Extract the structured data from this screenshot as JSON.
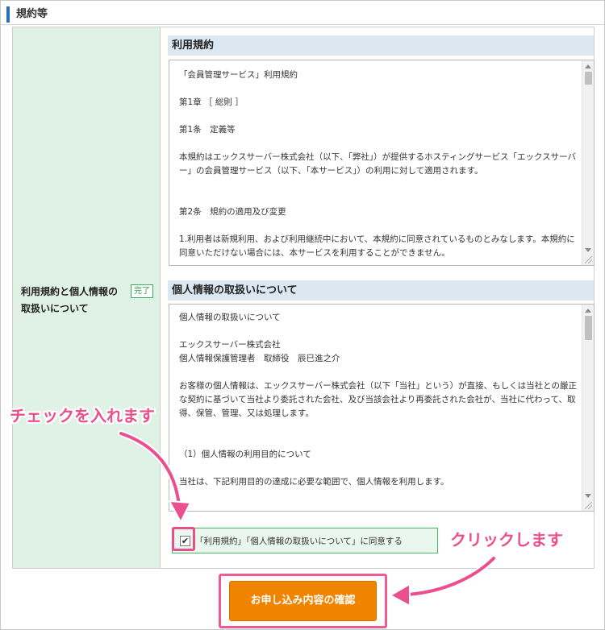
{
  "section": {
    "title": "規約等"
  },
  "row": {
    "label": "利用規約と個人情報の取扱いについて",
    "status_badge": "完了"
  },
  "terms": {
    "heading": "利用規約",
    "lines": [
      "「会員管理サービス」利用規約",
      "",
      "第1章 ［ 総則 ］",
      "",
      "第1条　定義等",
      "",
      "本規約はエックスサーバー株式会社（以下、「弊社」）が提供するホスティングサービス「エックスサーバー」の会員管理サービス（以下、「本サービス」）の利用に対して適用されます。",
      "",
      "",
      "第2条　規約の適用及び変更",
      "",
      "1.利用者は新規利用、および利用継続中において、本規約に同意されているものとみなします。本規約に同意いただけない場合には、本サービスを利用することができません。"
    ]
  },
  "privacy": {
    "heading": "個人情報の取扱いについて",
    "lines": [
      "個人情報の取扱いについて",
      "",
      "エックスサーバー株式会社",
      "個人情報保護管理者　取締役　辰巳進之介",
      "",
      "お客様の個人情報は、エックスサーバー株式会社（以下「当社」という）が直接、もしくは当社との厳正な契約に基づいて当社より委託された会社、及び当該会社より再委託された会社が、当社に代わって、取得、保管、管理、又は処理します。",
      "",
      "",
      "（1）個人情報の利用目的について",
      "",
      "当社は、下記利用目的の達成に必要な範囲で、個人情報を利用します。"
    ]
  },
  "agreement": {
    "checked": true,
    "check_mark": "✔",
    "label": "「利用規約」「個人情報の取扱いについて」に同意する"
  },
  "confirm_button": {
    "label": "お申し込み内容の確認"
  },
  "annotations": {
    "check_callout": "チェックを入れます",
    "click_callout": "クリックします",
    "color": "#ec4f8d"
  },
  "colors": {
    "accent": "#2a6ebb",
    "label_bg": "#e0f1e6",
    "heading_bg": "#dbe8f2",
    "button": "#f08300",
    "success": "#3cab5c"
  }
}
